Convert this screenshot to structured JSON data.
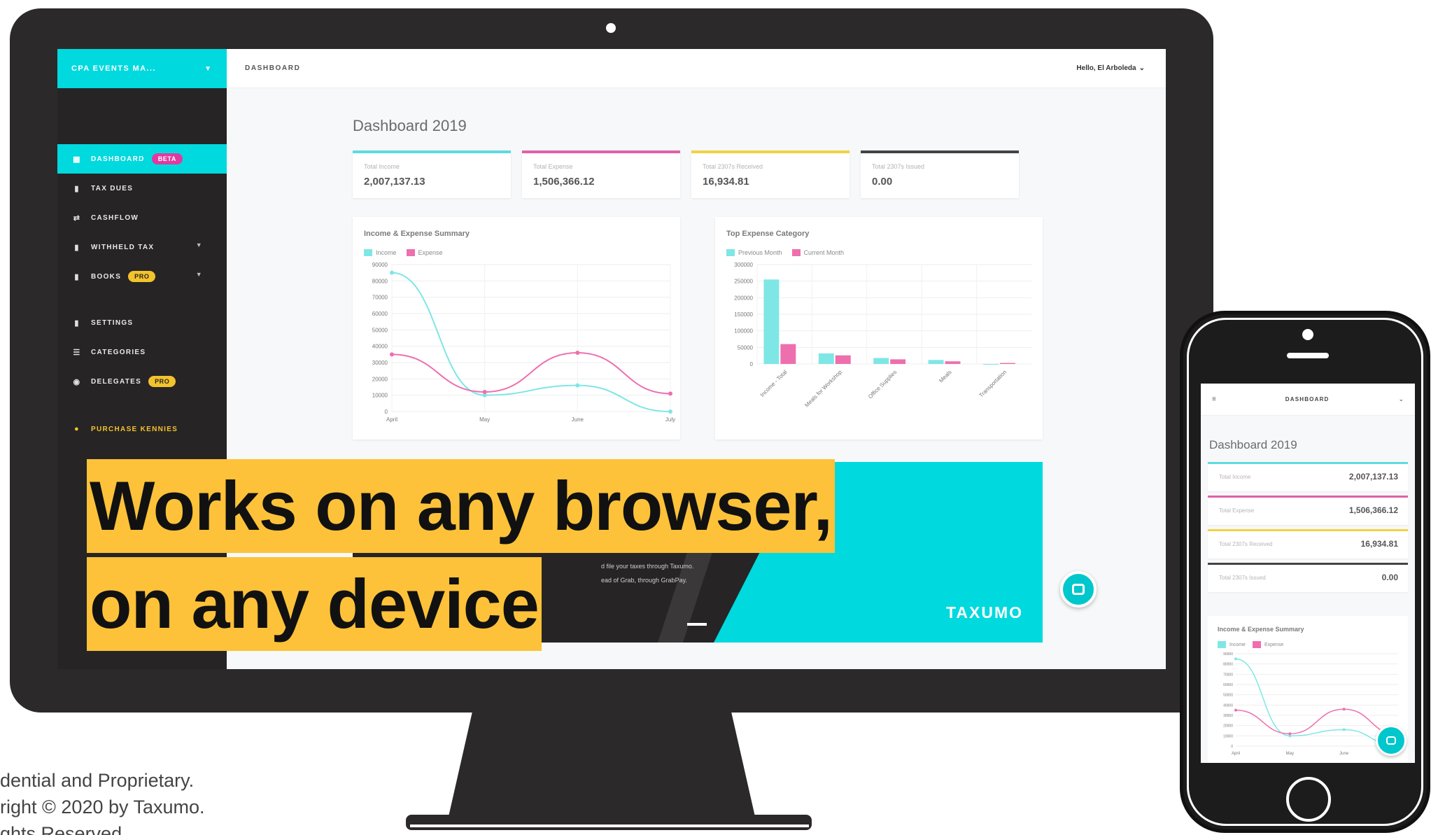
{
  "colors": {
    "accent": "#00d9de",
    "income": "#7fe6e6",
    "expense": "#ee6fae",
    "pro": "#f2c32c",
    "beta": "#e03aa1",
    "headline_bg": "#fdc239"
  },
  "sidebar": {
    "org_name": "CPA EVENTS MA...",
    "items": [
      {
        "label": "DASHBOARD",
        "icon": "dashboard-icon",
        "badge": "BETA",
        "active": true
      },
      {
        "label": "TAX DUES",
        "icon": "document-icon"
      },
      {
        "label": "CASHFLOW",
        "icon": "flow-icon"
      },
      {
        "label": "WITHHELD TAX",
        "icon": "file-icon",
        "caret": true
      },
      {
        "label": "BOOKS",
        "icon": "book-icon",
        "badge": "PRO",
        "caret": true
      },
      {
        "label": "SETTINGS",
        "icon": "settings-icon"
      },
      {
        "label": "CATEGORIES",
        "icon": "list-icon"
      },
      {
        "label": "DELEGATES",
        "icon": "people-icon",
        "badge": "PRO"
      },
      {
        "label": "PURCHASE KENNIES",
        "icon": "coin-icon"
      }
    ]
  },
  "topbar": {
    "title": "DASHBOARD",
    "user": "Hello, El Arboleda"
  },
  "dashboard": {
    "heading": "Dashboard 2019",
    "stats": [
      {
        "label": "Total Income",
        "value": "2,007,137.13",
        "color": "#5fdbe0"
      },
      {
        "label": "Total Expense",
        "value": "1,506,366.12",
        "color": "#e061a8"
      },
      {
        "label": "Total 2307s Received",
        "value": "16,934.81",
        "color": "#f2d245"
      },
      {
        "label": "Total 2307s Issued",
        "value": "0.00",
        "color": "#444444"
      }
    ]
  },
  "chart_data": [
    {
      "type": "line",
      "title": "Income & Expense Summary",
      "categories": [
        "April",
        "May",
        "June",
        "July"
      ],
      "series": [
        {
          "name": "Income",
          "values": [
            85000,
            10000,
            16000,
            0
          ]
        },
        {
          "name": "Expense",
          "values": [
            35000,
            12000,
            36000,
            11000
          ]
        }
      ],
      "yticks": [
        "0",
        "10000",
        "20000",
        "30000",
        "40000",
        "50000",
        "60000",
        "70000",
        "80000",
        "90000"
      ],
      "ylim": [
        0,
        90000
      ]
    },
    {
      "type": "bar",
      "title": "Top Expense Category",
      "categories": [
        "Income - Total",
        "Meals for Workshop",
        "Office Supplies",
        "Meals",
        "Transportation"
      ],
      "series": [
        {
          "name": "Previous Month",
          "values": [
            255000,
            32000,
            18000,
            12000,
            0
          ]
        },
        {
          "name": "Current Month",
          "values": [
            60000,
            26000,
            14000,
            8000,
            3000
          ]
        }
      ],
      "yticks": [
        "0",
        "50000",
        "100000",
        "150000",
        "200000",
        "250000",
        "300000"
      ],
      "ylim": [
        0,
        300000
      ]
    }
  ],
  "promo": {
    "line1": "d file your taxes through Taxumo.",
    "line2": "ead of Grab, through GrabPay.",
    "logo": "TAXUMO"
  },
  "headline": {
    "line1": "Works on any browser,",
    "line2": "on any device"
  },
  "footer": {
    "line1": "dential and Proprietary.",
    "line2": "right © 2020 by Taxumo.",
    "line3": "ghts Reserved"
  },
  "phone": {
    "title": "DASHBOARD",
    "heading": "Dashboard 2019",
    "stats": [
      {
        "label": "Total Income",
        "value": "2,007,137.13",
        "color": "#5fdbe0"
      },
      {
        "label": "Total Expense",
        "value": "1,506,366.12",
        "color": "#e061a8"
      },
      {
        "label": "Total 2307s Received",
        "value": "16,934.81",
        "color": "#f2d245"
      },
      {
        "label": "Total 2307s Issued",
        "value": "0.00",
        "color": "#444444"
      }
    ],
    "panel_title": "Income & Expense Summary",
    "legend": [
      "Income",
      "Expense"
    ],
    "xticks": [
      "April",
      "May",
      "June"
    ],
    "yticks": [
      "0",
      "10000",
      "20000",
      "30000",
      "40000",
      "50000",
      "60000",
      "70000",
      "80000",
      "90000"
    ]
  }
}
